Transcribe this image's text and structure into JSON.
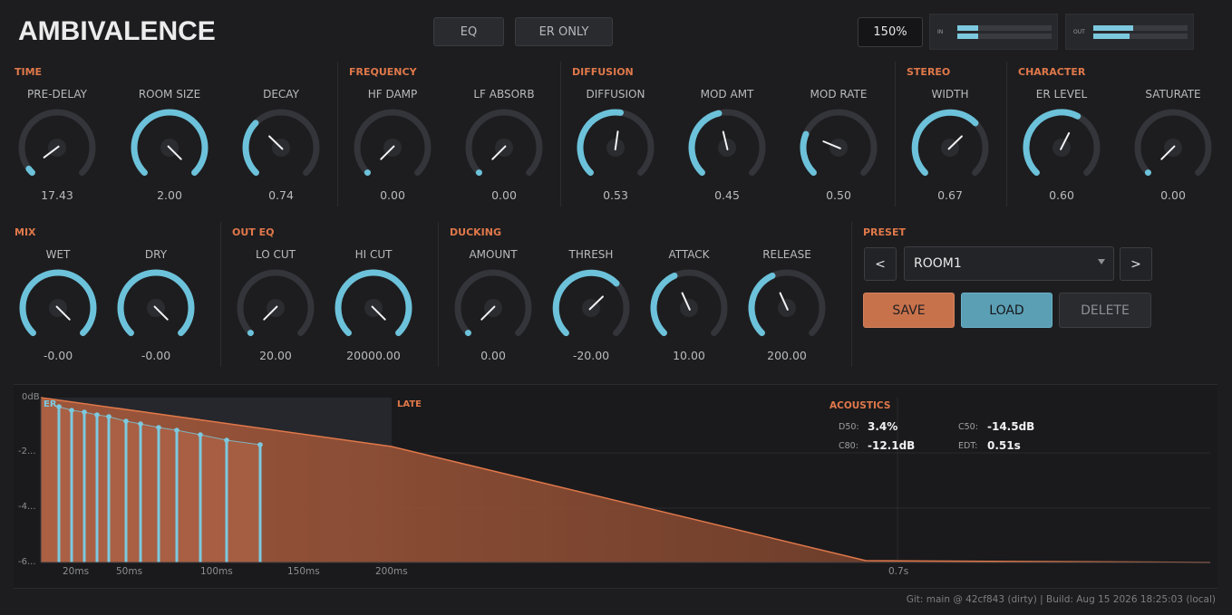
{
  "header": {
    "title": "AMBIVALENCE",
    "eq_label": "EQ",
    "er_only_label": "ER ONLY",
    "zoom": "150%",
    "meter_in_label": "IN",
    "meter_out_label": "OUT",
    "meter_in_levels": [
      0.22,
      0.22
    ],
    "meter_out_levels": [
      0.42,
      0.38
    ]
  },
  "sections": {
    "time": "TIME",
    "frequency": "FREQUENCY",
    "diffusion": "DIFFUSION",
    "stereo": "STEREO",
    "character": "CHARACTER",
    "mix": "MIX",
    "out_eq": "OUT EQ",
    "ducking": "DUCKING",
    "preset": "PRESET"
  },
  "knobs": [
    {
      "id": "pre-delay",
      "label": "PRE-DELAY",
      "value": "17.43",
      "level": 0.03
    },
    {
      "id": "room-size",
      "label": "ROOM SIZE",
      "value": "2.00",
      "level": 1.0
    },
    {
      "id": "decay",
      "label": "DECAY",
      "value": "0.74",
      "level": 0.33
    },
    {
      "id": "hf-damp",
      "label": "HF DAMP",
      "value": "0.00",
      "level": 0.0
    },
    {
      "id": "lf-absorb",
      "label": "LF ABSORB",
      "value": "0.00",
      "level": 0.0
    },
    {
      "id": "diffusion",
      "label": "DIFFUSION",
      "value": "0.53",
      "level": 0.53
    },
    {
      "id": "mod-amt",
      "label": "MOD AMT",
      "value": "0.45",
      "level": 0.45
    },
    {
      "id": "mod-rate",
      "label": "MOD RATE",
      "value": "0.50",
      "level": 0.25
    },
    {
      "id": "width",
      "label": "WIDTH",
      "value": "0.67",
      "level": 0.67
    },
    {
      "id": "er-level",
      "label": "ER LEVEL",
      "value": "0.60",
      "level": 0.6
    },
    {
      "id": "saturate",
      "label": "SATURATE",
      "value": "0.00",
      "level": 0.0
    },
    {
      "id": "wet",
      "label": "WET",
      "value": "-0.00",
      "level": 1.0
    },
    {
      "id": "dry",
      "label": "DRY",
      "value": "-0.00",
      "level": 1.0
    },
    {
      "id": "lo-cut",
      "label": "LO CUT",
      "value": "20.00",
      "level": 0.0
    },
    {
      "id": "hi-cut",
      "label": "HI CUT",
      "value": "20000.00",
      "level": 1.0
    },
    {
      "id": "amount",
      "label": "AMOUNT",
      "value": "0.00",
      "level": 0.0
    },
    {
      "id": "thresh",
      "label": "THRESH",
      "value": "-20.00",
      "level": 0.67
    },
    {
      "id": "attack",
      "label": "ATTACK",
      "value": "10.00",
      "level": 0.41
    },
    {
      "id": "release",
      "label": "RELEASE",
      "value": "200.00",
      "level": 0.41
    }
  ],
  "preset": {
    "prev": "<",
    "next": ">",
    "selected": "ROOM1",
    "save": "SAVE",
    "load": "LOAD",
    "delete": "DELETE"
  },
  "graph": {
    "er_label": "ER",
    "late_label": "LATE",
    "y_ticks": [
      "0dB",
      "-2...",
      "-4...",
      "-6..."
    ],
    "x_ticks": [
      "20ms",
      "50ms",
      "100ms",
      "150ms",
      "200ms",
      "0.7s"
    ]
  },
  "acoustics": {
    "title": "ACOUSTICS",
    "d50_key": "D50:",
    "d50": "3.4%",
    "c50_key": "C50:",
    "c50": "-14.5dB",
    "c80_key": "C80:",
    "c80": "-12.1dB",
    "edt_key": "EDT:",
    "edt": "0.51s"
  },
  "footer": "Git: main @ 42cf843 (dirty)  |  Build: Aug 15 2026 18:25:03 (local)",
  "colors": {
    "accent": "#e0784a",
    "knob_arc": "#6cc2da",
    "load": "#5b9fb5",
    "save": "#c8724c"
  }
}
